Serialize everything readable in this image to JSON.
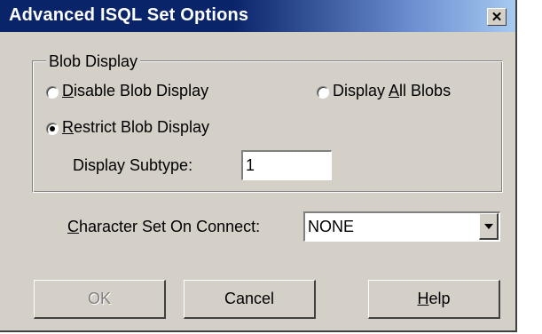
{
  "window": {
    "title": "Advanced ISQL Set Options",
    "close_glyph": "✕"
  },
  "blob_display": {
    "group_label": "Blob Display",
    "options": [
      {
        "label_pre": "",
        "label_key": "D",
        "label_post": "isable Blob Display",
        "checked": false
      },
      {
        "label_pre": "Display ",
        "label_key": "A",
        "label_post": "ll Blobs",
        "checked": false
      },
      {
        "label_pre": "",
        "label_key": "R",
        "label_post": "estrict Blob Display",
        "checked": true
      }
    ],
    "subtype_label": "Display Subtype:",
    "subtype_value": "1"
  },
  "charset": {
    "label_key": "C",
    "label_post": "haracter Set On Connect:",
    "selected": "NONE"
  },
  "buttons": {
    "ok": "OK",
    "cancel": "Cancel",
    "help_key": "H",
    "help_post": "elp"
  },
  "icons": {
    "close": "close-icon",
    "dropdown": "chevron-down-icon",
    "radio": "radio-button-icon"
  },
  "colors": {
    "title_bar_start": "#0a246a",
    "title_bar_end": "#a6caf0",
    "dialog_face": "#d4d0c8"
  }
}
